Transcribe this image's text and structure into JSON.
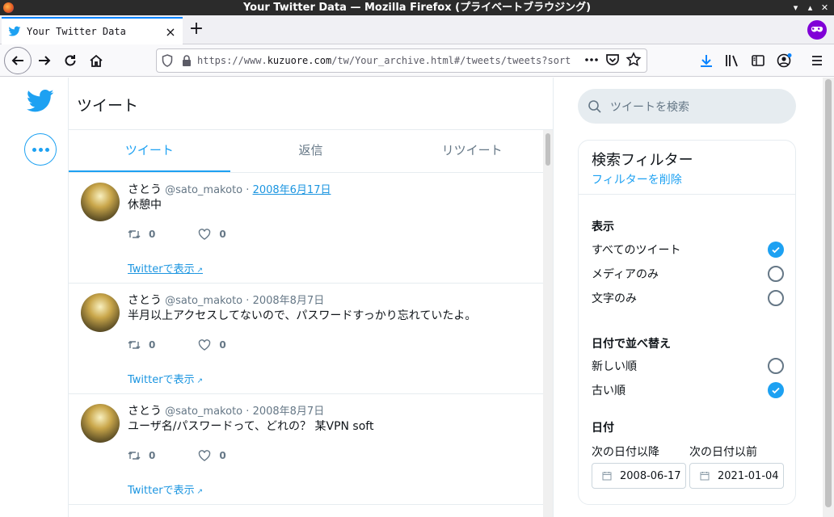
{
  "window": {
    "title": "Your Twitter Data — Mozilla Firefox (プライベートブラウジング)"
  },
  "browser": {
    "tab_title": "Your Twitter Data",
    "url_prefix": "https://www.",
    "url_host": "kuzuore.com",
    "url_rest": "/tw/Your_archive.html#/tweets/tweets?sort=a",
    "icons": [
      "back-icon",
      "forward-icon",
      "reload-icon",
      "home-icon",
      "shield-icon",
      "lock-icon",
      "more-icon",
      "pocket-icon",
      "star-icon",
      "download-icon",
      "library-icon",
      "sidebar-icon",
      "account-icon",
      "menu-icon",
      "private-browsing-icon"
    ]
  },
  "main": {
    "title": "ツイート",
    "tabs": [
      {
        "label": "ツイート",
        "active": true
      },
      {
        "label": "返信",
        "active": false
      },
      {
        "label": "リツイート",
        "active": false
      }
    ],
    "tweets": [
      {
        "name": "さとう",
        "handle": "@sato_makoto",
        "sep": "·",
        "date": "2008年6月17日",
        "text": "休憩中",
        "retweets": "0",
        "likes": "0",
        "link": "Twitterで表示"
      },
      {
        "name": "さとう",
        "handle": "@sato_makoto",
        "sep": "·",
        "date": "2008年8月7日",
        "text": "半月以上アクセスしてないので、パスワードすっかり忘れていたよ。",
        "retweets": "0",
        "likes": "0",
        "link": "Twitterで表示"
      },
      {
        "name": "さとう",
        "handle": "@sato_makoto",
        "sep": "·",
        "date": "2008年8月7日",
        "text": "ユーザ名/パスワードって、どれの？ 某VPN soft",
        "retweets": "0",
        "likes": "0",
        "link": "Twitterで表示"
      }
    ]
  },
  "sidebar": {
    "search_placeholder": "ツイートを検索",
    "filter_title": "検索フィルター",
    "filter_clear": "フィルターを削除",
    "display_title": "表示",
    "display_options": [
      {
        "label": "すべてのツイート",
        "checked": true
      },
      {
        "label": "メディアのみ",
        "checked": false
      },
      {
        "label": "文字のみ",
        "checked": false
      }
    ],
    "sort_title": "日付で並べ替え",
    "sort_options": [
      {
        "label": "新しい順",
        "checked": false
      },
      {
        "label": "古い順",
        "checked": true
      }
    ],
    "date_title": "日付",
    "date_from_label": "次の日付以降",
    "date_to_label": "次の日付以前",
    "date_from": "2008-06-17",
    "date_to": "2021-01-04"
  },
  "colors": {
    "accent": "#1da1f2",
    "link": "#1b95e0",
    "muted": "#657786",
    "titlebar": "#2b2b2b",
    "private": "#8000d7"
  }
}
